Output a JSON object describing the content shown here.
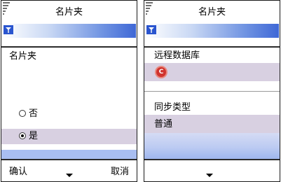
{
  "left_screen": {
    "title": "名片夹",
    "field_label": "名片夹",
    "options": [
      {
        "label": "否",
        "selected": false
      },
      {
        "label": "是",
        "selected": true
      }
    ],
    "softkeys": {
      "left": "确认",
      "right": "取消"
    }
  },
  "right_screen": {
    "title": "名片夹",
    "remote_db_label": "远程数据库",
    "remote_db_icon_letter": "C",
    "sync_type_label": "同步类型",
    "sync_type_value": "普通"
  },
  "icons": {
    "status": "antenna-icon",
    "softkey_center": "chevron-down-icon",
    "remote_db": "network-icon"
  },
  "colors": {
    "highlight": "#d8d0e1",
    "accent_blue": "#3f68d6",
    "bottom_strip": "#a9bef1"
  }
}
